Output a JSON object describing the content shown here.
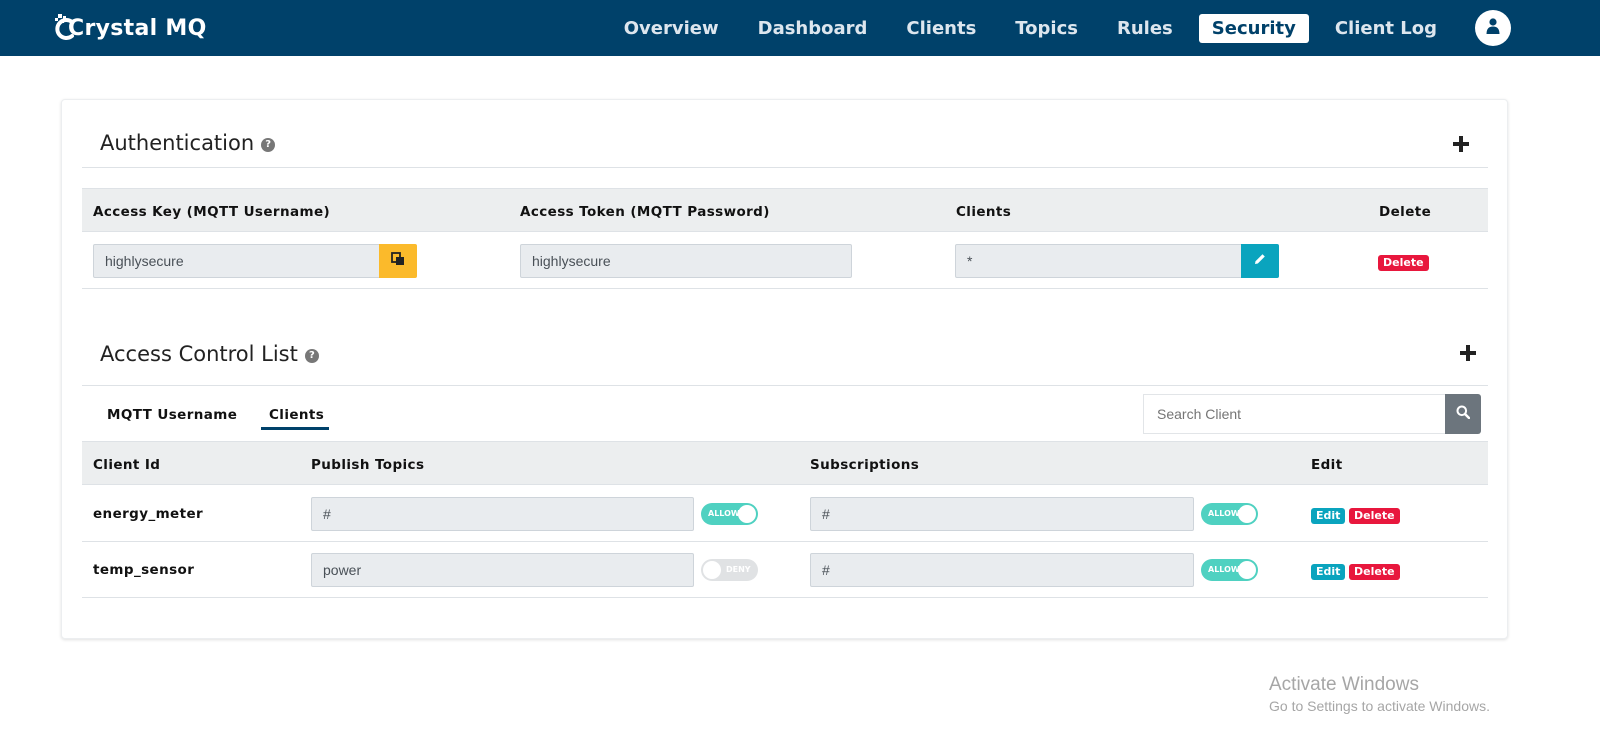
{
  "nav": {
    "brand": "Crystal MQ",
    "links": [
      {
        "label": "Overview",
        "active": false
      },
      {
        "label": "Dashboard",
        "active": false
      },
      {
        "label": "Clients",
        "active": false
      },
      {
        "label": "Topics",
        "active": false
      },
      {
        "label": "Rules",
        "active": false
      },
      {
        "label": "Security",
        "active": true
      },
      {
        "label": "Client Log",
        "active": false
      }
    ],
    "avatar_icon": "user-icon"
  },
  "authentication": {
    "title": "Authentication",
    "help_icon": "question-circle-icon",
    "add_icon": "plus-icon",
    "headers": {
      "access_key": "Access Key (MQTT Username)",
      "access_token": "Access Token (MQTT Password)",
      "clients": "Clients",
      "delete": "Delete"
    },
    "rows": [
      {
        "access_key": "highlysecure",
        "access_token": "highlysecure",
        "clients": "*",
        "delete_label": "Delete",
        "copy_icon": "copy-icon",
        "edit_icon": "pencil-icon"
      }
    ]
  },
  "acl": {
    "title": "Access Control List",
    "help_icon": "question-circle-icon",
    "add_icon": "plus-icon",
    "tabs": [
      {
        "label": "MQTT Username",
        "active": false
      },
      {
        "label": "Clients",
        "active": true
      }
    ],
    "search": {
      "placeholder": "Search Client",
      "icon": "search-icon"
    },
    "headers": {
      "client_id": "Client Id",
      "publish_topics": "Publish Topics",
      "subscriptions": "Subscriptions",
      "edit": "Edit"
    },
    "rows": [
      {
        "client_id": "energy_meter",
        "publish_topics": "#",
        "publish_toggle": {
          "on": true,
          "label": "ALLOW"
        },
        "subscriptions": "#",
        "subscribe_toggle": {
          "on": true,
          "label": "ALLOW"
        },
        "edit_label": "Edit",
        "delete_label": "Delete"
      },
      {
        "client_id": "temp_sensor",
        "publish_topics": "power",
        "publish_toggle": {
          "on": false,
          "label": "DENY"
        },
        "subscriptions": "#",
        "subscribe_toggle": {
          "on": true,
          "label": "ALLOW"
        },
        "edit_label": "Edit",
        "delete_label": "Delete"
      }
    ]
  },
  "watermark": {
    "line1": "Activate Windows",
    "line2": "Go to Settings to activate Windows."
  },
  "colors": {
    "nav_bg": "#00416a",
    "accent_yellow": "#fbba2b",
    "accent_teal": "#0aa4be",
    "danger": "#e8173d",
    "toggle_on": "#4fd1c1",
    "toggle_off": "#e0e2e4"
  }
}
